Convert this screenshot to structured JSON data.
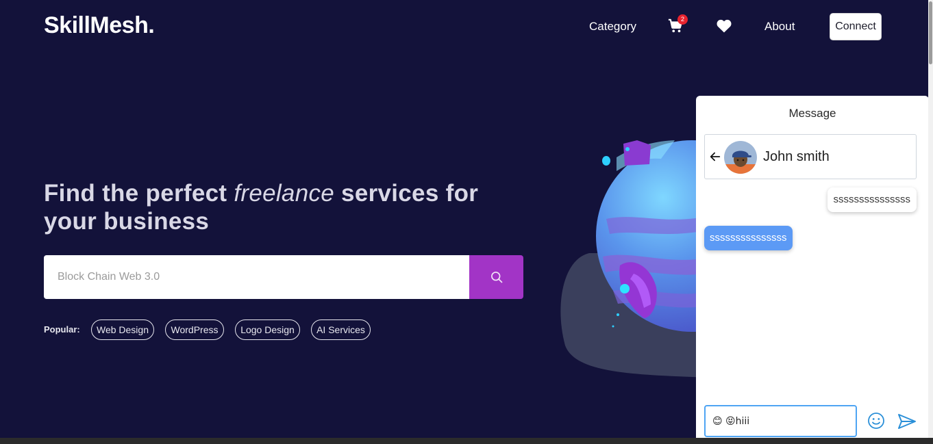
{
  "header": {
    "logo": "SkillMesh.",
    "nav": {
      "category": "Category",
      "about": "About",
      "connect": "Connect"
    },
    "cart_count": "2",
    "icons": [
      "cart-icon",
      "heart-icon"
    ]
  },
  "hero": {
    "title_part1": "Find the perfect ",
    "title_italic": "freelance",
    "title_part2": " services for your business",
    "search_placeholder": "Block Chain Web 3.0",
    "search_value": "",
    "popular_label": "Popular:",
    "popular_tags": [
      "Web Design",
      "WordPress",
      "Logo Design",
      "AI Services"
    ]
  },
  "chat": {
    "title": "Message",
    "contact_name": "John smith",
    "messages": [
      {
        "direction": "outgoing",
        "text": "sssssssssssssss"
      },
      {
        "direction": "incoming",
        "text": "sssssssssssssss"
      }
    ],
    "composer_value": "😊 😝hiii"
  },
  "colors": {
    "background": "#13123a",
    "search_button": "#a234c6",
    "incoming_bubble": "#5c9af5",
    "composer_border": "#4ea4f3",
    "badge": "#e8232e"
  }
}
